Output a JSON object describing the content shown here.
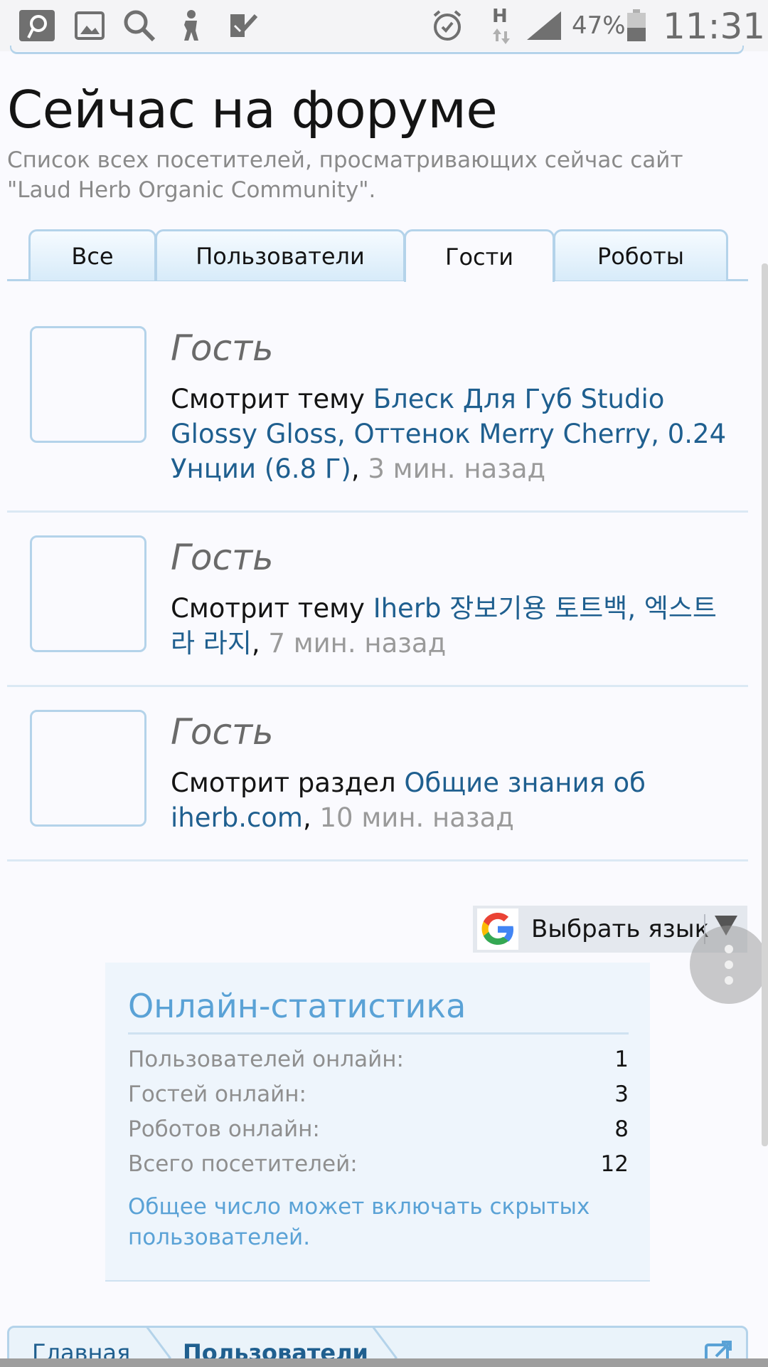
{
  "status_bar": {
    "battery": "47%",
    "time": "11:31",
    "network": "H"
  },
  "page": {
    "title": "Сейчас на форуме",
    "description": "Список всех посетителей, просматривающих сейчас сайт \"Laud Herb Organic Community\"."
  },
  "tabs": [
    {
      "label": "Все",
      "active": false
    },
    {
      "label": "Пользователи",
      "active": false
    },
    {
      "label": "Гости",
      "active": true
    },
    {
      "label": "Роботы",
      "active": false
    }
  ],
  "guests": [
    {
      "name": "Гость",
      "action": "Смотрит тему ",
      "link": "Блеск Для Губ Studio Glossy Gloss, Оттенок Merry Cherry, 0.24 Унции (6.8 Г)",
      "separator": ", ",
      "ago": "3 мин. назад"
    },
    {
      "name": "Гость",
      "action": "Смотрит тему ",
      "link": "Iherb 장보기용 토트백, 엑스트라 라지",
      "separator": ", ",
      "ago": "7 мин. назад"
    },
    {
      "name": "Гость",
      "action": "Смотрит раздел ",
      "link": "Общие знания об iherb.com",
      "separator": ", ",
      "ago": "10 мин. назад"
    }
  ],
  "translate": {
    "label": "Выбрать язык",
    "logo_letter": "G"
  },
  "stats": {
    "title": "Онлайн-статистика",
    "rows": [
      {
        "label": "Пользователей онлайн:",
        "value": "1"
      },
      {
        "label": "Гостей онлайн:",
        "value": "3"
      },
      {
        "label": "Роботов онлайн:",
        "value": "8"
      },
      {
        "label": "Всего посетителей:",
        "value": "12"
      }
    ],
    "note": "Общее число может включать скрытых пользователей."
  },
  "breadcrumb": {
    "items": [
      "Главная",
      "Пользователи"
    ]
  },
  "colors": {
    "link": "#1f5f8f",
    "accent": "#5aa2d6",
    "border": "#b4d3ea"
  }
}
